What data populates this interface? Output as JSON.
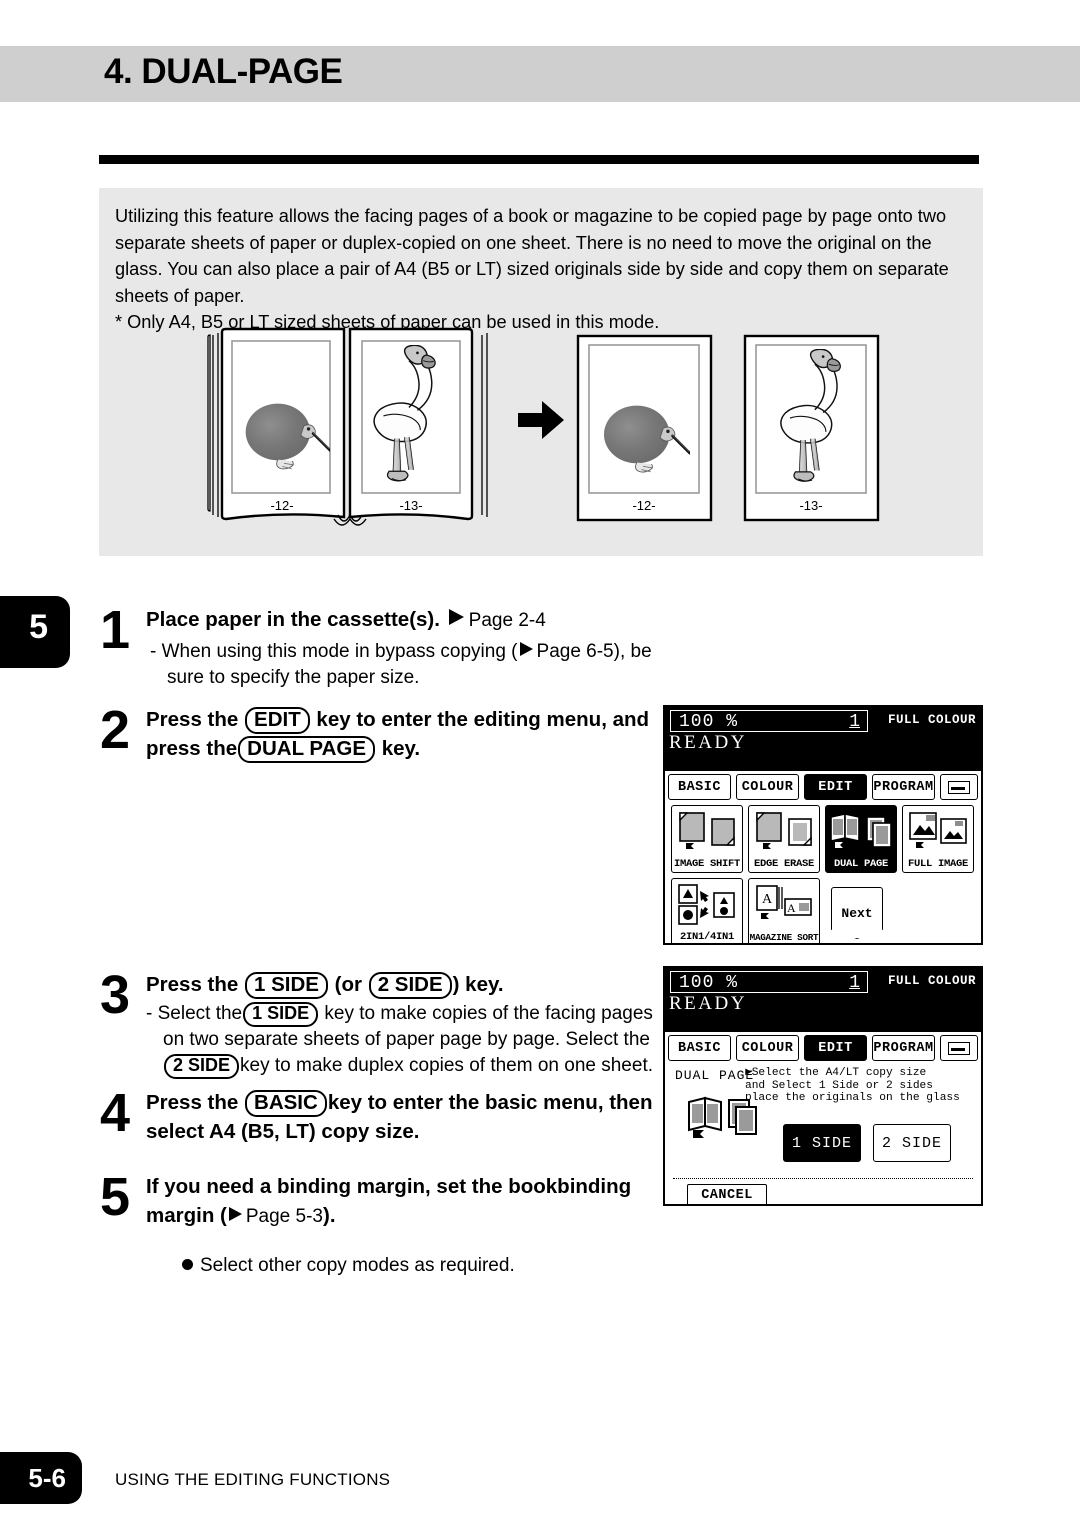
{
  "header": {
    "title": "4. DUAL-PAGE"
  },
  "intro": {
    "paragraph_lines": [
      "Utilizing this feature allows the facing pages of a book or magazine to be copied page by page onto two",
      "separate sheets of paper or duplex-copied on one sheet. There is no need to move the original on the",
      "glass. You can also place a pair of A4 (B5 or LT) sized originals side by side and copy them on separate",
      "sheets of paper."
    ],
    "note": "* Only A4, B5 or LT sized sheets of paper can be used in this mode."
  },
  "illustration": {
    "book_left_page_number": "-12-",
    "book_right_page_number": "-13-",
    "sheet_left_page_number": "-12-",
    "sheet_right_page_number": "-13-",
    "left_art": "kiwi-bird",
    "right_art": "flamingo-bird",
    "arrow": "right-arrow-icon"
  },
  "chapter_tab": {
    "number": "5"
  },
  "steps": [
    {
      "number": "1",
      "head_prefix": "Place paper in the cassette(s).",
      "head_ref": "Page 2-4",
      "sub_lines": [
        "- When using this mode in bypass copying (",
        "Page 6-5), be",
        "sure to specify the paper size."
      ]
    },
    {
      "number": "2",
      "head_line1_a": "Press the",
      "head_line1_key": "EDIT",
      "head_line1_b": "key to enter the editing menu, and",
      "head_line2_a": "press the",
      "head_line2_key": "DUAL PAGE",
      "head_line2_b": "key."
    },
    {
      "number": "3",
      "head_a": "Press the",
      "head_key1": "1 SIDE",
      "head_b": "(or",
      "head_key2": "2 SIDE",
      "head_c": ") key.",
      "sub_a": "- Select the",
      "sub_key1": "1 SIDE",
      "sub_b": "key to make copies of the facing pages",
      "sub_c": "on two separate sheets of paper page by page. Select the",
      "sub_key2": "2 SIDE",
      "sub_d": "key to make duplex copies of them on one sheet."
    },
    {
      "number": "4",
      "head_a": "Press the",
      "head_key": "BASIC",
      "head_b": "key to enter the basic menu, then",
      "head_line2": "select A4 (B5, LT) copy size."
    },
    {
      "number": "5",
      "head_line1": "If you need a binding margin, set the bookbinding",
      "head_line2_a": "margin (",
      "head_line2_ref": "Page 5-3",
      "head_line2_b": ").",
      "note": "Select other copy modes as required."
    }
  ],
  "lcd_edit_menu": {
    "ratio": "100  %",
    "copies": "1",
    "colour_mode": "FULL COLOUR",
    "status": "READY",
    "tabs": [
      {
        "label": "BASIC",
        "selected": false
      },
      {
        "label": "COLOUR",
        "selected": false
      },
      {
        "label": "EDIT",
        "selected": true
      },
      {
        "label": "PROGRAM",
        "selected": false
      }
    ],
    "tab_icon": "keypad-icon",
    "functions": [
      {
        "label": "IMAGE SHIFT",
        "selected": false
      },
      {
        "label": "EDGE ERASE",
        "selected": false
      },
      {
        "label": "DUAL  PAGE",
        "selected": true
      },
      {
        "label": "FULL IMAGE",
        "selected": false
      },
      {
        "label": "2IN1/4IN1",
        "selected": false
      },
      {
        "label": "MAGAZINE SORT",
        "selected": false
      }
    ],
    "next_label": "Next"
  },
  "lcd_dual_page": {
    "ratio": "100  %",
    "copies": "1",
    "colour_mode": "FULL COLOUR",
    "status": "READY",
    "tabs": [
      {
        "label": "BASIC",
        "selected": false
      },
      {
        "label": "COLOUR",
        "selected": false
      },
      {
        "label": "EDIT",
        "selected": true
      },
      {
        "label": "PROGRAM",
        "selected": false
      }
    ],
    "tab_icon": "keypad-icon",
    "mode_label": "DUAL PAGE",
    "message": "Select the A4/LT copy size\nand Select 1 Side or 2 sides\nplace the originals on the glass",
    "buttons": [
      {
        "label": "1 SIDE",
        "selected": true
      },
      {
        "label": "2 SIDE",
        "selected": false
      }
    ],
    "cancel_label": "CANCEL"
  },
  "footer": {
    "page_number": "5-6",
    "section": "USING THE EDITING FUNCTIONS"
  }
}
